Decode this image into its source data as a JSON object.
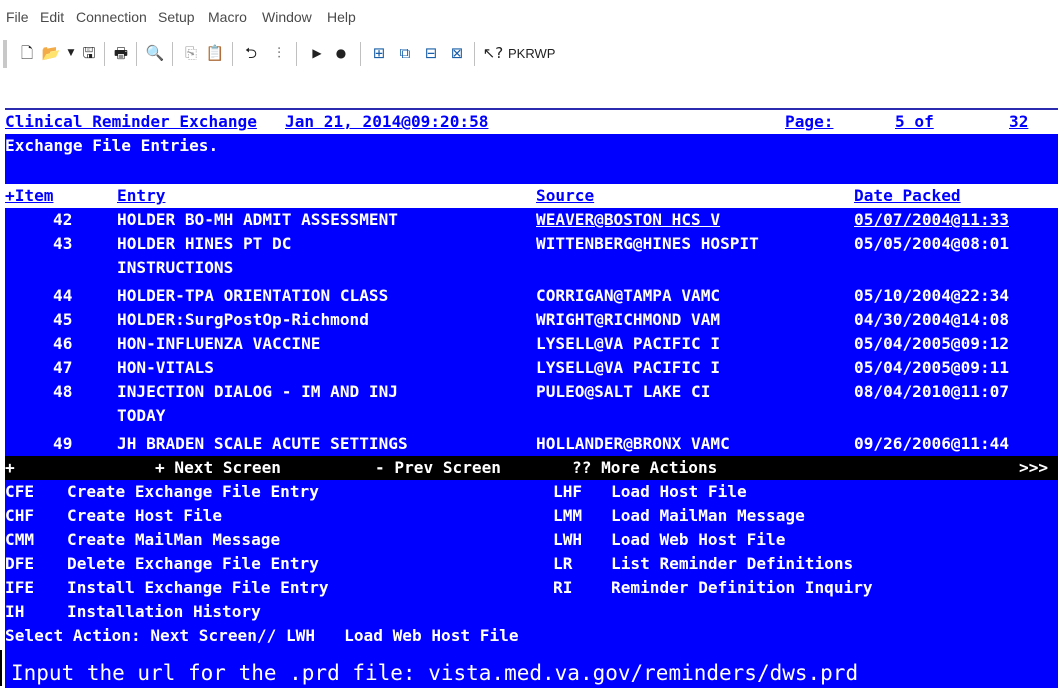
{
  "menu": [
    "File",
    "Edit",
    "Connection",
    "Setup",
    "Macro",
    "Window",
    "Help"
  ],
  "toolbar": {
    "icons": [
      "new-document-icon",
      "open-folder-icon",
      "save-icon",
      "print-icon",
      "find-icon",
      "copy-icon",
      "paste-icon",
      "connect-icon",
      "disconnect-icon",
      "play-macro-icon",
      "record-macro-icon",
      "window-tile-icon",
      "window-cascade-icon",
      "window-arrange-icon",
      "window-maximize-icon",
      "context-help-icon"
    ],
    "session_label": "PKRWP"
  },
  "terminal": {
    "header": {
      "title": "Clinical Reminder Exchange",
      "datetime": "Jan 21, 2014@09:20:58",
      "page_label": "Page:",
      "page_value": "5 of",
      "page_total": "32"
    },
    "subtitle": "Exchange File Entries.",
    "columns": {
      "item": "+Item",
      "entry": "Entry",
      "source": "Source",
      "date": "Date Packed"
    },
    "rows": [
      {
        "item": "42",
        "entry": "HOLDER BO-MH ADMIT ASSESSMENT",
        "source": "WEAVER@BOSTON HCS V",
        "date": "05/07/2004@11:33"
      },
      {
        "item": "43",
        "entry": "HOLDER HINES PT DC",
        "source": "WITTENBERG@HINES HOSPIT",
        "date": "05/05/2004@08:01"
      },
      {
        "item": "",
        "entry": "INSTRUCTIONS",
        "source": "",
        "date": ""
      },
      {
        "item": "44",
        "entry": "HOLDER-TPA ORIENTATION CLASS",
        "source": "CORRIGAN@TAMPA VAMC",
        "date": "05/10/2004@22:34"
      },
      {
        "item": "45",
        "entry": "HOLDER:SurgPostOp-Richmond",
        "source": "WRIGHT@RICHMOND VAM",
        "date": "04/30/2004@14:08"
      },
      {
        "item": "46",
        "entry": "HON-INFLUENZA VACCINE",
        "source": "LYSELL@VA PACIFIC I",
        "date": "05/04/2005@09:12"
      },
      {
        "item": "47",
        "entry": "HON-VITALS",
        "source": "LYSELL@VA PACIFIC I",
        "date": "05/04/2005@09:11"
      },
      {
        "item": "48",
        "entry": "INJECTION DIALOG - IM AND INJ",
        "source": "PULEO@SALT LAKE CI",
        "date": "08/04/2010@11:07"
      },
      {
        "item": "",
        "entry": "TODAY",
        "source": "",
        "date": ""
      },
      {
        "item": "49",
        "entry": "JH BRADEN SCALE ACUTE SETTINGS",
        "source": "HOLLANDER@BRONX VAMC",
        "date": "09/26/2006@11:44"
      }
    ],
    "nav": {
      "marker": "+",
      "next": "+ Next Screen",
      "prev": "- Prev Screen",
      "more": "?? More Actions",
      "arrows": ">>>"
    },
    "actions_left": [
      {
        "code": "CFE",
        "label": "Create Exchange File Entry"
      },
      {
        "code": "CHF",
        "label": "Create Host File"
      },
      {
        "code": "CMM",
        "label": "Create MailMan Message"
      },
      {
        "code": "DFE",
        "label": "Delete Exchange File Entry"
      },
      {
        "code": "IFE",
        "label": "Install Exchange File Entry"
      },
      {
        "code": "IH",
        "label": "Installation History"
      }
    ],
    "actions_right": [
      {
        "code": "LHF",
        "label": "Load Host File"
      },
      {
        "code": "LMM",
        "label": "Load MailMan Message"
      },
      {
        "code": "LWH",
        "label": "Load Web Host File"
      },
      {
        "code": "LR",
        "label": "List Reminder Definitions"
      },
      {
        "code": "RI",
        "label": "Reminder Definition Inquiry"
      }
    ],
    "prompt": "Select Action: Next Screen// LWH   Load Web Host File",
    "input_prompt": "Input the url for the .prd file: vista.med.va.gov/reminders/dws.prd"
  }
}
